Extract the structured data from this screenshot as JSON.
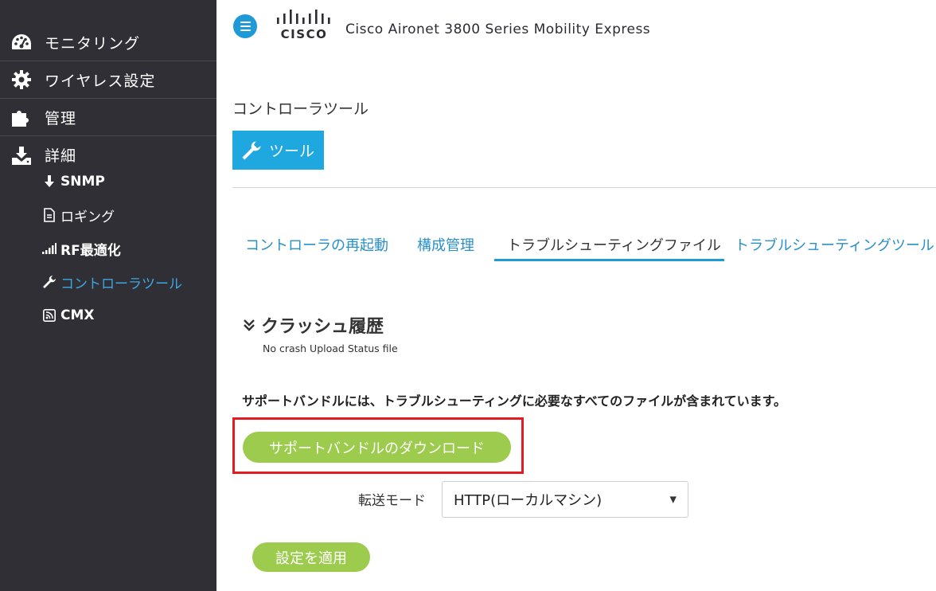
{
  "header": {
    "product_title": "Cisco Aironet 3800 Series Mobility Express",
    "logo_text": "CISCO"
  },
  "sidebar": {
    "items": [
      {
        "label": "モニタリング",
        "icon": "dashboard-gauge-icon"
      },
      {
        "label": "ワイヤレス設定",
        "icon": "gear-icon"
      },
      {
        "label": "管理",
        "icon": "puzzle-icon"
      },
      {
        "label": "詳細",
        "icon": "download-tray-icon"
      }
    ],
    "subitems": [
      {
        "label": "SNMP",
        "icon": "arrow-down-icon"
      },
      {
        "label": "ロギング",
        "icon": "log-file-icon"
      },
      {
        "label": "RF最適化",
        "icon": "signal-bars-icon"
      },
      {
        "label": "コントローラツール",
        "icon": "wrench-icon",
        "active": true
      },
      {
        "label": "CMX",
        "icon": "rss-icon"
      }
    ]
  },
  "page": {
    "title": "コントローラツール",
    "tool_button_label": "ツール"
  },
  "tabs": [
    {
      "label": "コントローラの再起動"
    },
    {
      "label": "構成管理"
    },
    {
      "label": "トラブルシューティングファイル",
      "active": true
    },
    {
      "label": "トラブルシューティングツール"
    }
  ],
  "crash": {
    "heading": "クラッシュ履歴",
    "status": "No crash Upload Status file"
  },
  "bundle": {
    "description": "サポートバンドルには、トラブルシューティングに必要なすべてのファイルが含まれています。",
    "download_label": "サポートバンドルのダウンロード"
  },
  "transfer": {
    "label": "転送モード",
    "selected": "HTTP(ローカルマシン)"
  },
  "apply_label": "設定を適用",
  "colors": {
    "sidebar_bg": "#2f2f35",
    "accent_blue": "#1fa8e0",
    "tab_link": "#2a90c8",
    "green_button": "#9ccb4e",
    "highlight_red": "#e31b23"
  }
}
